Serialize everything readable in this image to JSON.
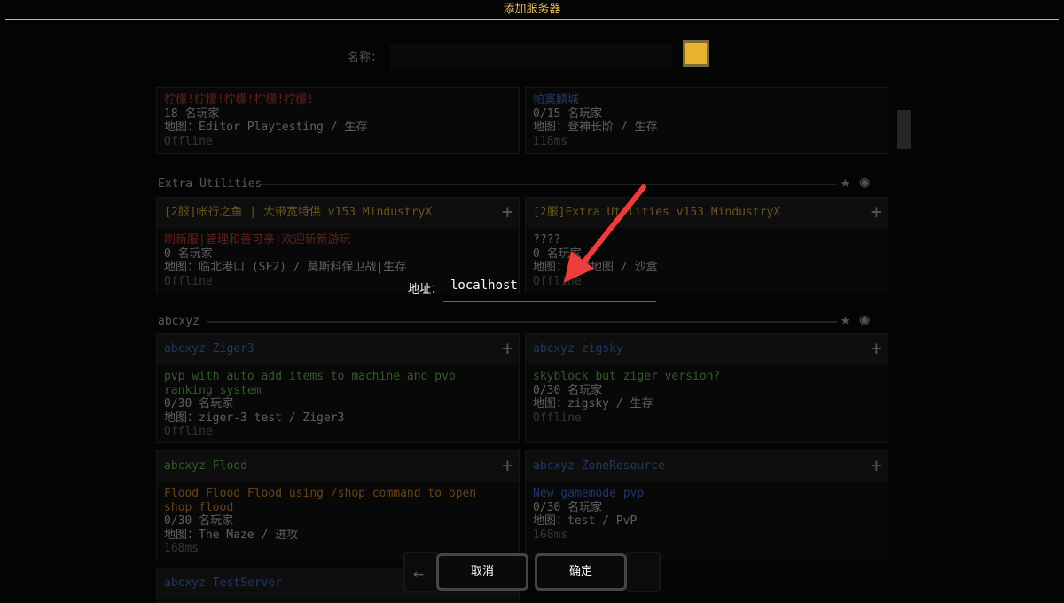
{
  "window": {
    "title": "添加服务器"
  },
  "form": {
    "name_label": "名称：",
    "swatch_color": "#e8b32c",
    "address_label": "地址：",
    "address_value": "localhost"
  },
  "buttons": {
    "cancel": "取消",
    "confirm": "确定"
  },
  "server_list": {
    "top_cards": [
      {
        "name": "柠檬!柠檬!柠檬!柠檬!柠檬!",
        "players": "18 名玩家",
        "map": "地图：Editor Playtesting / 生存",
        "ping": "Offline"
      },
      {
        "name": "帕寞麟城",
        "players": "0/15 名玩家",
        "map": "地图：登神长阶 / 生存",
        "ping": "118ms"
      }
    ],
    "sections": [
      {
        "title": "Extra Utilities",
        "cards": [
          {
            "header": "[2服]帐行之鱼 | 大带宽特供  v153 MindustryX",
            "desc": "刷新服|管理和善可亲|欢迎新新游玩",
            "players": "0 名玩家",
            "map": "地图：临北港口 (SF2) / 莫斯科保卫战|生存",
            "ping": "Offline"
          },
          {
            "header": "[2服]Extra Utilities  v153 MindustryX",
            "desc": "????",
            "players": "0 名玩家",
            "map": "地图：测试地图 / 沙盒",
            "ping": "Offline"
          }
        ]
      },
      {
        "title": "abcxyz",
        "cards": [
          {
            "header": "abcxyz  Ziger3",
            "desc": "pvp with auto add items to machine and pvp ranking system",
            "players": "0/30 名玩家",
            "map": "地图：ziger-3 test / Ziger3",
            "ping": "Offline"
          },
          {
            "header": "abcxyz  zigsky",
            "desc": "skyblock but ziger version?",
            "players": "0/30 名玩家",
            "map": "地图：zigsky / 生存",
            "ping": "Offline"
          },
          {
            "header": "abcxyz  Flood",
            "desc": "Flood Flood Flood using /shop command to open shop flood",
            "players": "0/30 名玩家",
            "map": "地图：The Maze / 进攻",
            "ping": "168ms"
          },
          {
            "header": "abcxyz  ZoneResource",
            "desc": "New gamemode pvp",
            "players": "0/30 名玩家",
            "map": "地图：test / PvP",
            "ping": "168ms"
          },
          {
            "header": "abcxyz  TestServer"
          }
        ]
      }
    ]
  }
}
